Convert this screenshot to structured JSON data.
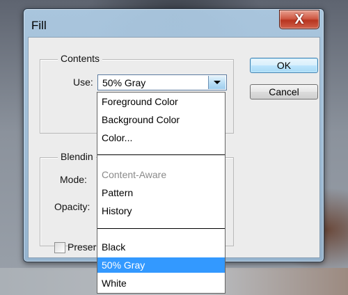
{
  "dialog": {
    "title": "Fill",
    "close_label": "X"
  },
  "contents": {
    "legend": "Contents",
    "use_label": "Use:",
    "use_value": "50% Gray"
  },
  "blending": {
    "legend": "Blendin",
    "mode_label": "Mode:",
    "opacity_label": "Opacity:",
    "preserve_label": "Preser"
  },
  "buttons": {
    "ok": "OK",
    "cancel": "Cancel"
  },
  "dropdown": {
    "group1": [
      "Foreground Color",
      "Background Color",
      "Color..."
    ],
    "group2": [
      "Content-Aware",
      "Pattern",
      "History"
    ],
    "group3": [
      "Black",
      "50% Gray",
      "White"
    ],
    "disabled_item": "Content-Aware",
    "selected_item": "50% Gray"
  },
  "colors": {
    "selection": "#3399ff",
    "window_frame": "#a8c4dc"
  }
}
